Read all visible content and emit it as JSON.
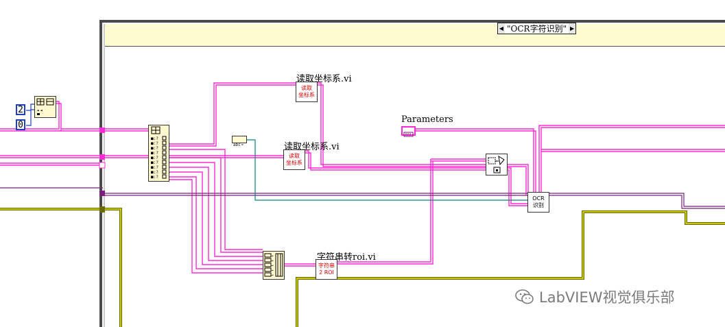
{
  "case_structure": {
    "selector_value": "\"OCR字符识别\"",
    "decrement_glyph": "◀",
    "increment_glyph": "▶"
  },
  "labels": {
    "read_coords_top": "读取坐标系.vi",
    "read_coords_mid": "读取坐标系.vi",
    "parameters": "Parameters",
    "string_to_roi": "字符串转roi.vi"
  },
  "subvi_icons": {
    "read_coords_top": "读取\n坐标系",
    "read_coords_mid": "读取\n坐标系",
    "string_to_roi": "字符串\n2 ROI",
    "ocr": "OCR\n识别"
  },
  "constants": {
    "top": "2",
    "bottom": "0"
  },
  "watermark": {
    "text": "LabVIEW视觉俱乐部",
    "icon": "wechat-icon"
  },
  "colors": {
    "wire_string": "#ff2bd6",
    "wire_cluster": "#7b1d7b",
    "wire_numeric": "#1f3fbf",
    "wire_error": "#6b6b00",
    "wire_error_fill": "#e8e800",
    "wire_teal": "#0a7f7f",
    "case_header": "#fffbd0"
  }
}
